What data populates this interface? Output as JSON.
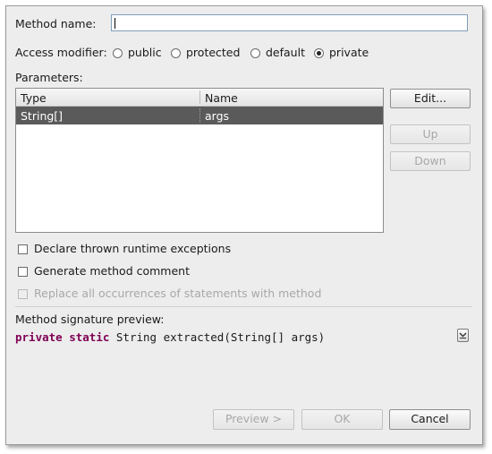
{
  "method_name": {
    "label": "Method name:",
    "value": ""
  },
  "access_modifier": {
    "label": "Access modifier:",
    "options": [
      {
        "label": "public",
        "selected": false
      },
      {
        "label": "protected",
        "selected": false
      },
      {
        "label": "default",
        "selected": false
      },
      {
        "label": "private",
        "selected": true
      }
    ]
  },
  "parameters": {
    "label": "Parameters:",
    "columns": [
      "Type",
      "Name"
    ],
    "rows": [
      {
        "type": "String[]",
        "name": "args",
        "selected": true
      }
    ]
  },
  "param_buttons": {
    "edit": "Edit...",
    "up": "Up",
    "down": "Down"
  },
  "checkboxes": [
    {
      "label": "Declare thrown runtime exceptions",
      "checked": false,
      "enabled": true
    },
    {
      "label": "Generate method comment",
      "checked": false,
      "enabled": true
    },
    {
      "label": "Replace all occurrences of statements with method",
      "checked": false,
      "enabled": false
    }
  ],
  "preview": {
    "label": "Method signature preview:",
    "keywords": [
      "private",
      "static"
    ],
    "rest": "String extracted(String[] args)"
  },
  "footer": {
    "preview": "Preview >",
    "ok": "OK",
    "cancel": "Cancel"
  }
}
